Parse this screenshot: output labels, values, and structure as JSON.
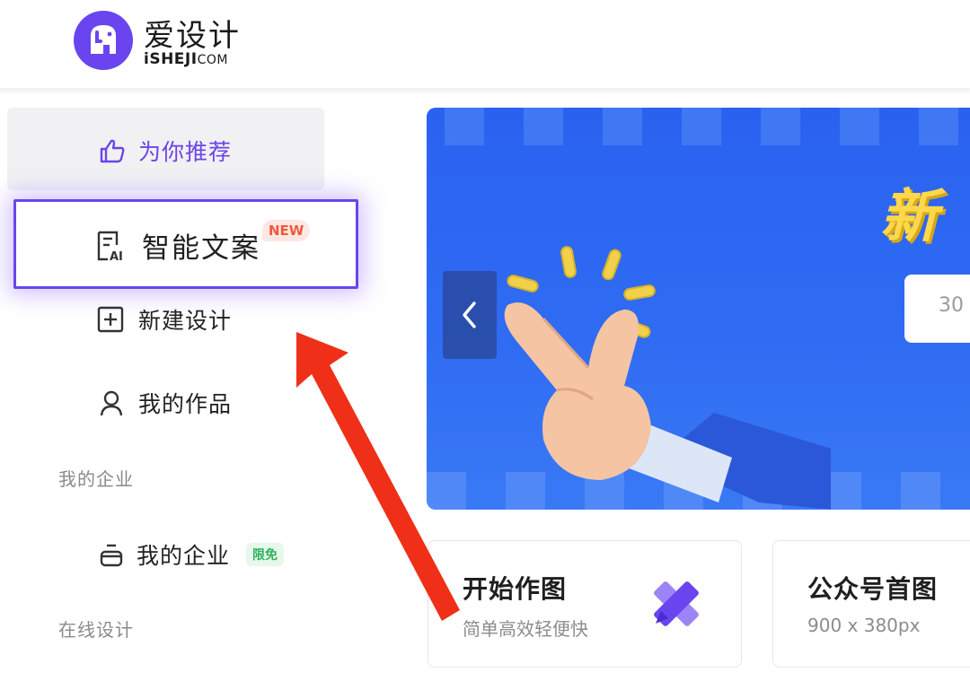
{
  "header": {
    "brand_cn": "爱设计",
    "brand_en": "iSHEJI",
    "brand_en_suffix": "COM",
    "logo_icon": "elephant-logo-icon"
  },
  "sidebar": {
    "items": [
      {
        "label": "为你推荐",
        "icon": "thumbs-up-icon",
        "active": true
      },
      {
        "label": "智能文案",
        "icon": "ai-document-icon",
        "badge": "NEW",
        "highlighted": true
      },
      {
        "label": "新建设计",
        "icon": "plus-square-icon"
      },
      {
        "label": "我的作品",
        "icon": "user-icon"
      }
    ],
    "section_company": "我的企业",
    "company_item": {
      "label": "我的企业",
      "icon": "briefcase-icon",
      "badge": "限免"
    },
    "section_online": "在线设计"
  },
  "banner": {
    "title_fragment": "新",
    "pill_text": "30",
    "prev_icon": "chevron-left-icon",
    "illustration": "finger-snap-hand-illustration"
  },
  "cards": [
    {
      "title": "开始作图",
      "subtitle": "简单高效轻便快",
      "icon": "pencil-ruler-icon"
    },
    {
      "title": "公众号首图",
      "subtitle": "900 x 380px"
    }
  ],
  "colors": {
    "accent": "#6a45ef",
    "banner_blue": "#2f6bf3",
    "banner_yellow": "#ffd84a",
    "annotation_red": "#ef2f17",
    "badge_new": "#f0593d",
    "badge_free": "#31b15e"
  }
}
